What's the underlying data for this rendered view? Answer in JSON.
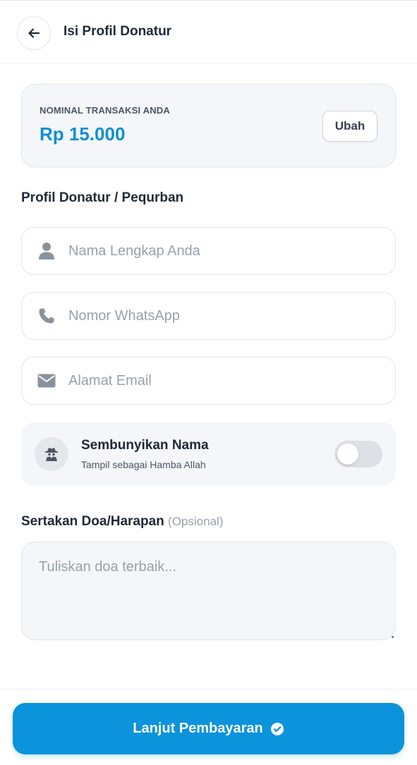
{
  "header": {
    "title": "Isi Profil Donatur",
    "back_icon": "arrow-left-icon"
  },
  "nominal": {
    "label": "NOMINAL TRANSAKSI ANDA",
    "amount": "Rp 15.000",
    "change_label": "Ubah"
  },
  "profile": {
    "section_title": "Profil Donatur / Pequrban",
    "fields": {
      "name": {
        "placeholder": "Nama Lengkap Anda",
        "value": "",
        "icon": "user-icon"
      },
      "phone": {
        "placeholder": "Nomor WhatsApp",
        "value": "",
        "icon": "phone-icon"
      },
      "email": {
        "placeholder": "Alamat Email",
        "value": "",
        "icon": "envelope-icon"
      }
    }
  },
  "hide_name": {
    "title": "Sembunyikan Nama",
    "subtitle": "Tampil sebagai Hamba Allah",
    "icon": "user-secret-icon",
    "enabled": false
  },
  "doa": {
    "title": "Sertakan Doa/Harapan",
    "optional_label": "(Opsional)",
    "placeholder": "Tuliskan doa terbaik...",
    "value": ""
  },
  "footer": {
    "submit_label": "Lanjut Pembayaran",
    "submit_icon": "check-circle-icon"
  },
  "colors": {
    "accent": "#0b93dc",
    "amount": "#0d8fd3",
    "card_bg": "#f4f6f9"
  }
}
